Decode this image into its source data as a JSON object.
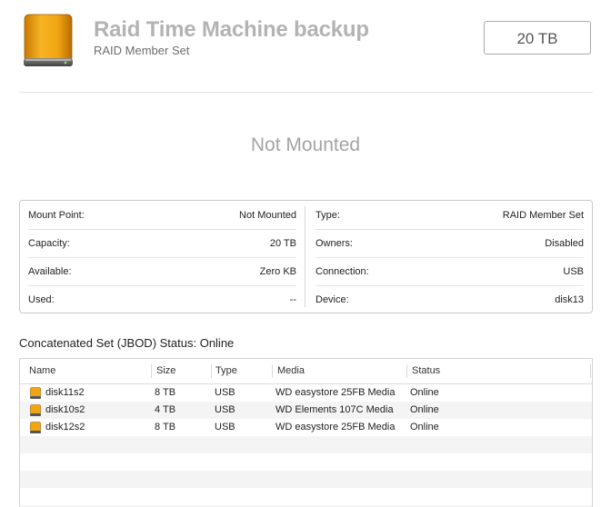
{
  "header": {
    "title": "Raid Time Machine backup",
    "subtitle": "RAID Member Set",
    "capacity": "20 TB",
    "icon": "external-drive-icon"
  },
  "mount_status": "Not Mounted",
  "info": {
    "left": [
      {
        "label": "Mount Point:",
        "value": "Not Mounted"
      },
      {
        "label": "Capacity:",
        "value": "20 TB"
      },
      {
        "label": "Available:",
        "value": "Zero KB"
      },
      {
        "label": "Used:",
        "value": "--"
      }
    ],
    "right": [
      {
        "label": "Type:",
        "value": "RAID Member Set"
      },
      {
        "label": "Owners:",
        "value": "Disabled"
      },
      {
        "label": "Connection:",
        "value": "USB"
      },
      {
        "label": "Device:",
        "value": "disk13"
      }
    ]
  },
  "set_status": "Concatenated Set (JBOD) Status: Online",
  "table": {
    "columns": [
      "Name",
      "Size",
      "Type",
      "Media",
      "Status"
    ],
    "rows": [
      {
        "name": "disk11s2",
        "size": "8 TB",
        "type": "USB",
        "media": "WD easystore 25FB Media",
        "status": "Online"
      },
      {
        "name": "disk10s2",
        "size": "4 TB",
        "type": "USB",
        "media": "WD Elements 107C Media",
        "status": "Online"
      },
      {
        "name": "disk12s2",
        "size": "8 TB",
        "type": "USB",
        "media": "WD easystore 25FB Media",
        "status": "Online"
      }
    ]
  },
  "colors": {
    "drive_orange": "#f0a010",
    "title_gray": "#b3b3b3",
    "stripe": "#f4f4f4"
  }
}
